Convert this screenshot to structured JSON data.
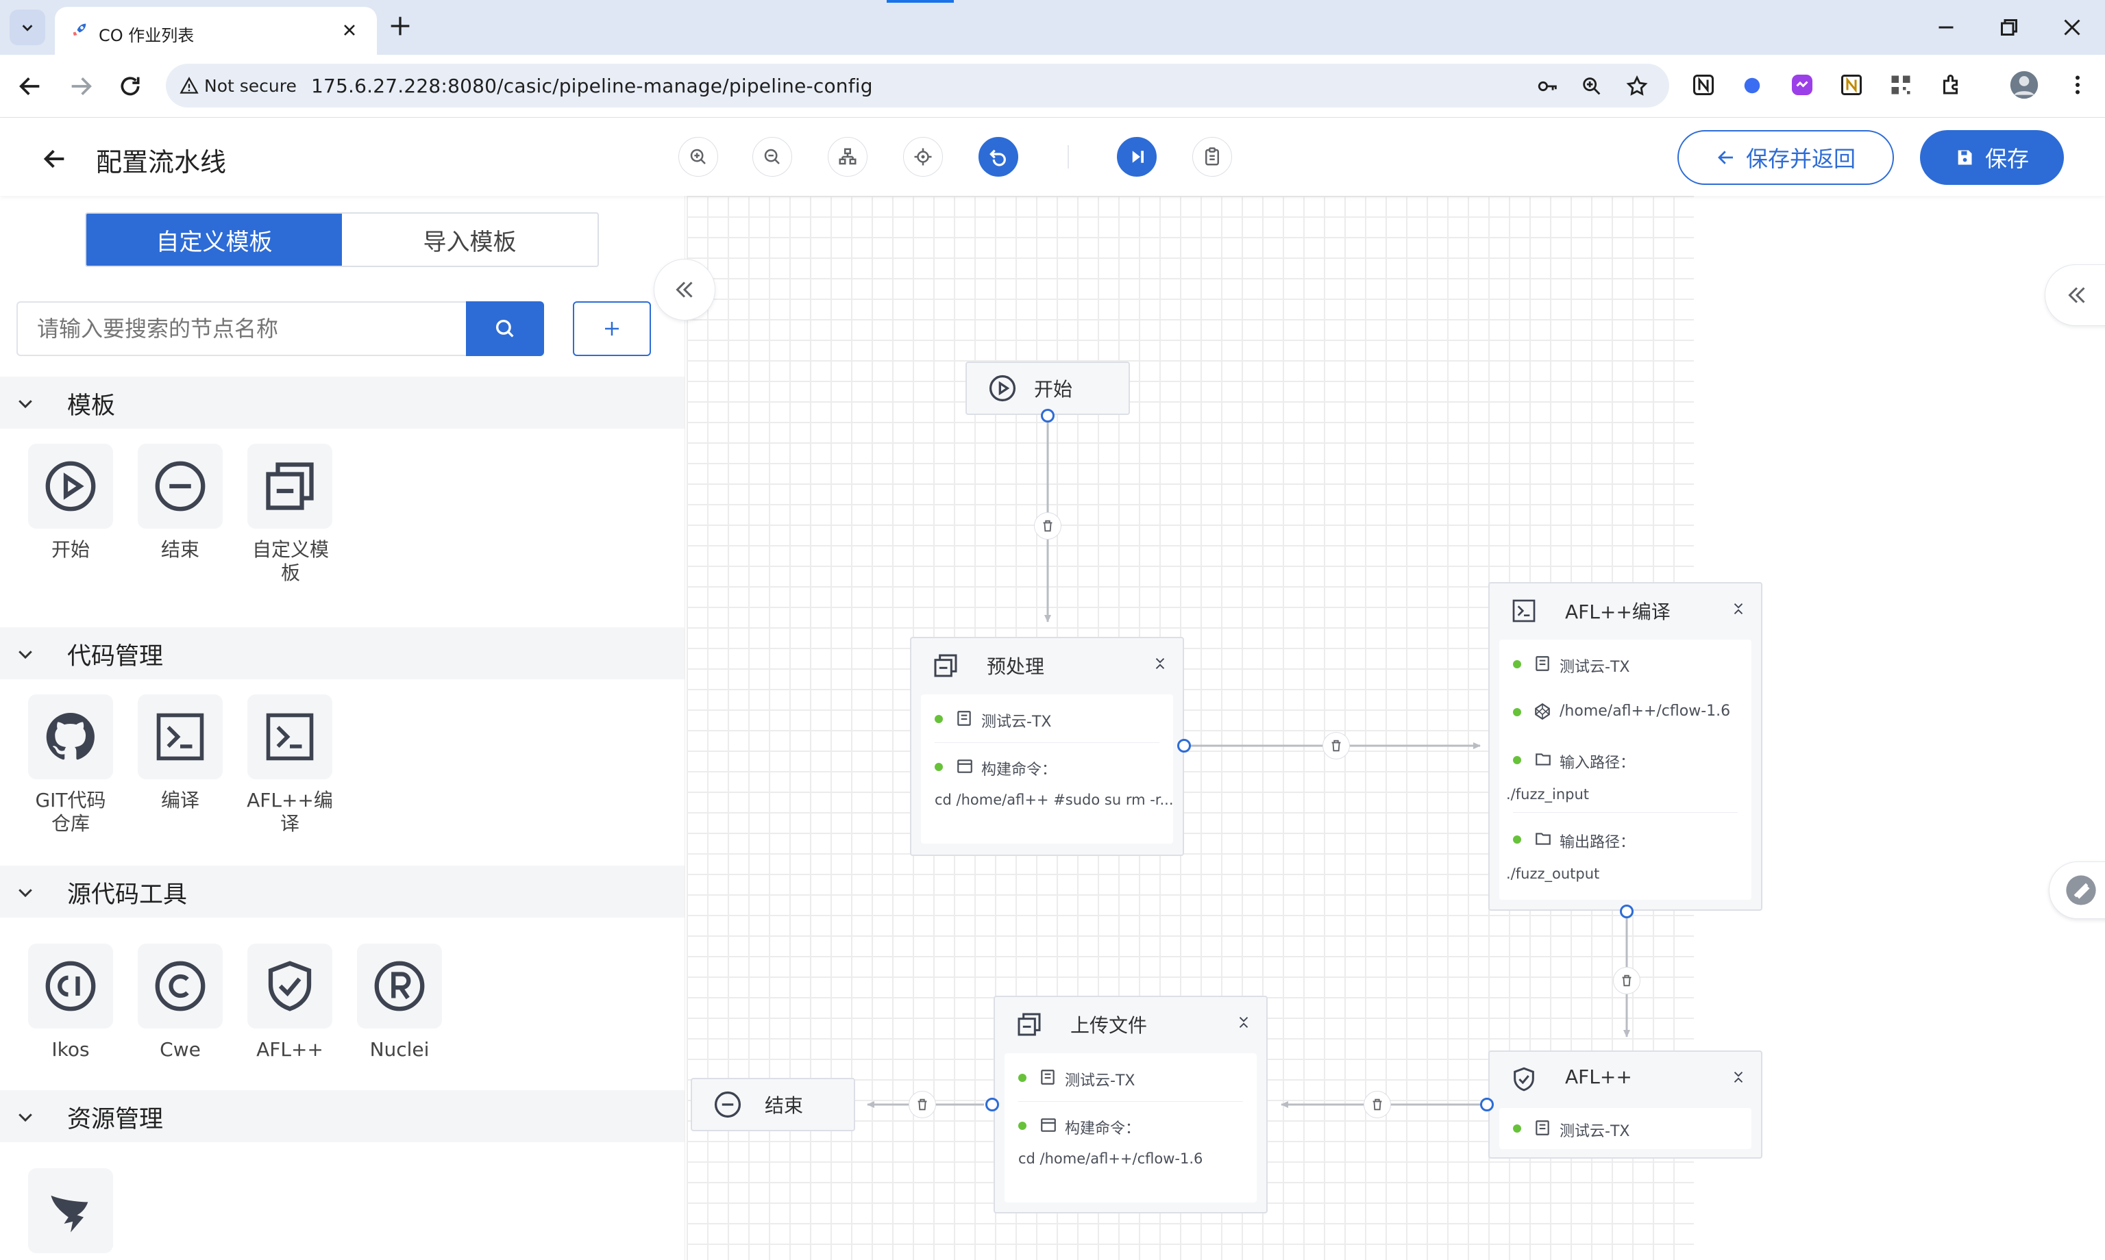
{
  "browser": {
    "tab_title": "CO 作业列表",
    "not_secure": "Not secure",
    "url": "175.6.27.228:8080/casic/pipeline-manage/pipeline-config"
  },
  "header": {
    "title": "配置流水线",
    "save_return": "保存并返回",
    "save": "保存"
  },
  "left_panel": {
    "tabs": [
      "自定义模板",
      "导入模板"
    ],
    "search_placeholder": "请输入要搜索的节点名称",
    "sections": [
      {
        "title": "模板",
        "items": [
          {
            "label": "开始",
            "icon": "play-circle-icon"
          },
          {
            "label": "结束",
            "icon": "minus-circle-icon"
          },
          {
            "label": "自定义模板",
            "icon": "copy-minus-icon"
          }
        ]
      },
      {
        "title": "代码管理",
        "items": [
          {
            "label": "GIT代码仓库",
            "icon": "github-icon"
          },
          {
            "label": "编译",
            "icon": "terminal-icon"
          },
          {
            "label": "AFL++编译",
            "icon": "terminal-icon"
          }
        ]
      },
      {
        "title": "源代码工具",
        "items": [
          {
            "label": "Ikos",
            "icon": "ci-circle-icon"
          },
          {
            "label": "Cwe",
            "icon": "copyright-icon"
          },
          {
            "label": "AFL++",
            "icon": "shield-check-icon"
          },
          {
            "label": "Nuclei",
            "icon": "registered-icon"
          }
        ]
      },
      {
        "title": "资源管理",
        "items": [
          {
            "label": "",
            "icon": "dingtalk-icon"
          }
        ]
      }
    ]
  },
  "nodes": {
    "start": {
      "label": "开始"
    },
    "end": {
      "label": "结束"
    },
    "preprocess": {
      "title": "预处理",
      "server": "测试云-TX",
      "cmd_label": "构建命令：",
      "cmd_value": "cd /home/afl++ #sudo su rm -r..."
    },
    "afl_compile": {
      "title": "AFL++编译",
      "server": "测试云-TX",
      "path": "/home/afl++/cflow-1.6",
      "input_label": "输入路径：",
      "input_value": "./fuzz_input",
      "output_label": "输出路径：",
      "output_value": "./fuzz_output"
    },
    "afl": {
      "title": "AFL++",
      "server": "测试云-TX"
    },
    "upload": {
      "title": "上传文件",
      "server": "测试云-TX",
      "cmd_label": "构建命令：",
      "cmd_value": "cd /home/afl++/cflow-1.6"
    }
  },
  "colors": {
    "primary": "#2d6cd6",
    "status_ok": "#67c23a",
    "edge": "#b9bcc2"
  }
}
